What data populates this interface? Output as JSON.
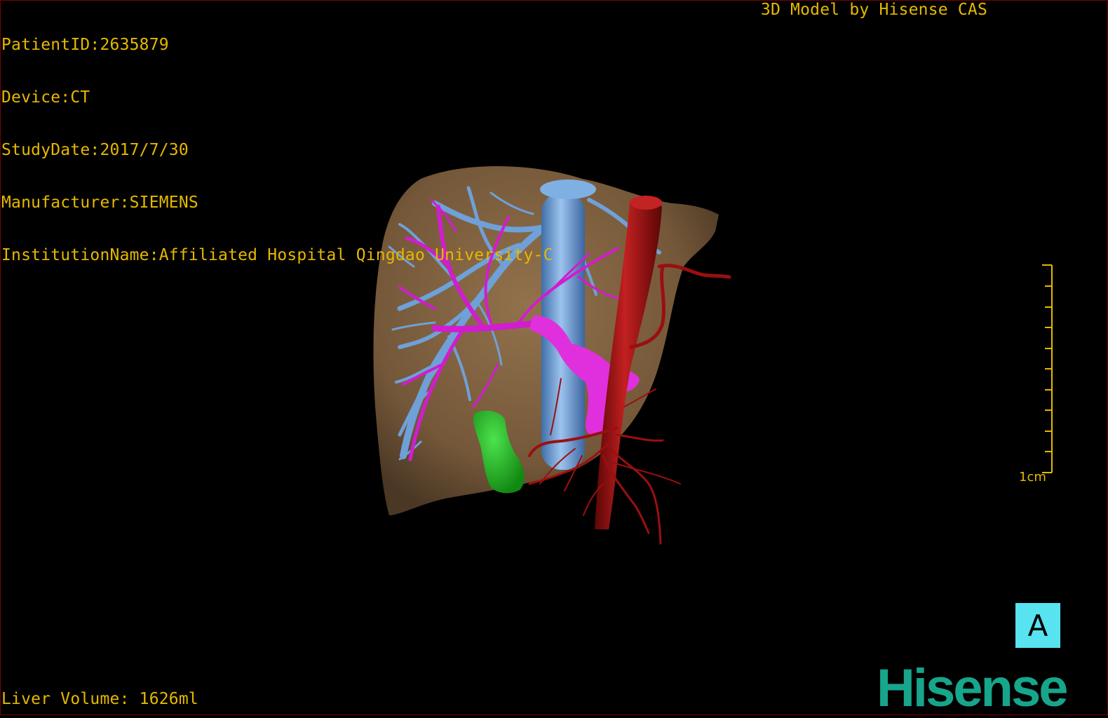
{
  "header": {
    "patient_id": "PatientID:2635879",
    "device": "Device:CT",
    "study_date": "StudyDate:2017/7/30",
    "manufacturer": "Manufacturer:SIEMENS",
    "institution": "InstitutionName:Affiliated Hospital Qingdao University-C"
  },
  "credit": "3D Model by Hisense CAS",
  "footer": {
    "liver_volume": "Liver Volume: 1626ml"
  },
  "scale_bar": {
    "label": "1cm"
  },
  "orientation": {
    "label": "A"
  },
  "brand": {
    "logo_text": "Hisense",
    "color": "#17a58b"
  },
  "colors": {
    "overlay_text": "#e6b800",
    "liver": "#8a6a45",
    "hepatic_vein": "#6fa0d8",
    "portal_vein": "#d21ccf",
    "artery": "#9b0f10",
    "gallbladder": "#22b022",
    "orientation_cube": "#57e3f0"
  },
  "structures": [
    "liver",
    "hepatic-veins",
    "portal-vein",
    "aorta",
    "hepatic-arteries",
    "gallbladder"
  ]
}
